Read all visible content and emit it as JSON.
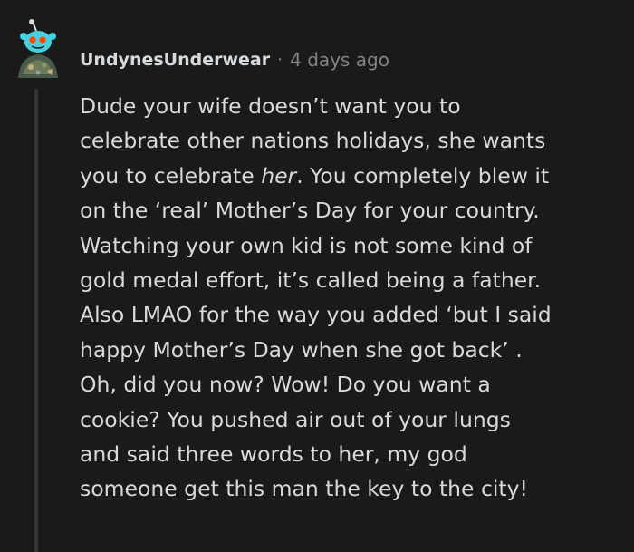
{
  "comment": {
    "username": "UndynesUnderwear",
    "separator": "·",
    "timestamp": "4 days ago",
    "avatar_icon": "snoo-avatar-icon",
    "body_lines": [
      "Dude your wife doesn’t want you to",
      "celebrate other nations holidays, she wants",
      "you to celebrate ",
      "her",
      ". You completely blew it",
      "on the ‘real’ Mother’s Day for your country.",
      "Watching your own kid is not some kind of",
      "gold medal effort, it’s called being a father.",
      "Also LMAO for the way you added ‘but I said",
      "happy Mother’s Day when she got back’ .",
      "Oh, did you now? Wow! Do you want a",
      "cookie? You pushed air out of your lungs",
      "and said three words to her, my god",
      "someone get this man the key to the city!"
    ]
  },
  "colors": {
    "background": "#1a1a1b",
    "text": "#d7dadc",
    "meta": "#818384",
    "thread_line": "#343536",
    "avatar_accent": "#46d1dc"
  }
}
